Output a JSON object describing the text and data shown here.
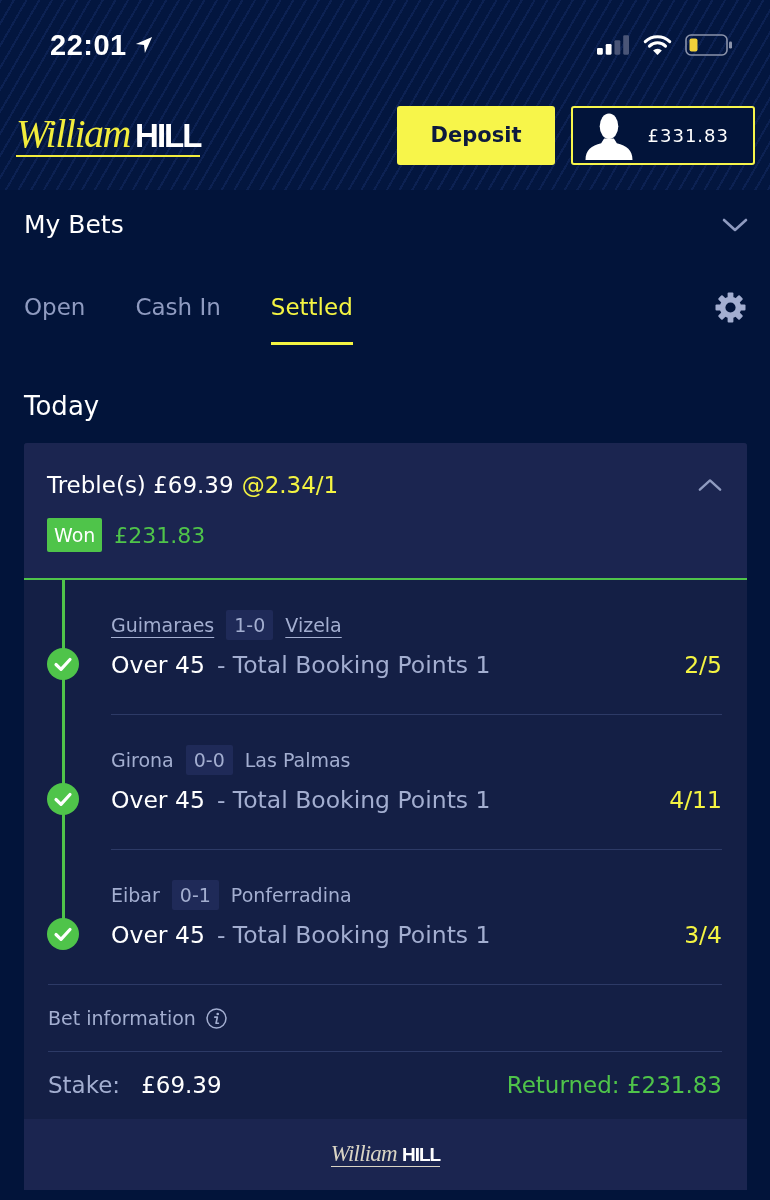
{
  "status_bar": {
    "time": "22:01"
  },
  "header": {
    "logo": {
      "script": "William",
      "wordmark": "HILL"
    },
    "deposit_button": "Deposit",
    "balance": "£331.83"
  },
  "section": {
    "title": "My Bets",
    "expanded": false
  },
  "tabs": [
    {
      "label": "Open",
      "selected": false
    },
    {
      "label": "Cash In",
      "selected": false
    },
    {
      "label": "Settled",
      "selected": true
    }
  ],
  "group_title": "Today",
  "bet": {
    "title": "Treble(s) £69.39",
    "odds": "@2.34/1",
    "expanded": true,
    "status": "Won",
    "return": "£231.83",
    "legs": [
      {
        "home": "Guimaraes",
        "score": "1-0",
        "away": "Vizela",
        "teams_linked": true,
        "selection": "Over 45",
        "market": "- Total Booking Points 1",
        "odds": "2/5",
        "won": true
      },
      {
        "home": "Girona",
        "score": "0-0",
        "away": "Las Palmas",
        "teams_linked": false,
        "selection": "Over 45",
        "market": "- Total Booking Points 1",
        "odds": "4/11",
        "won": true
      },
      {
        "home": "Eibar",
        "score": "0-1",
        "away": "Ponferradina",
        "teams_linked": false,
        "selection": "Over 45",
        "market": "- Total Booking Points 1",
        "odds": "3/4",
        "won": true
      }
    ],
    "info_label": "Bet information",
    "stake_label": "Stake:",
    "stake_value": "£69.39",
    "returned": "Returned: £231.83"
  },
  "footer": {
    "logo": {
      "script": "William",
      "wordmark": "HILL"
    }
  }
}
